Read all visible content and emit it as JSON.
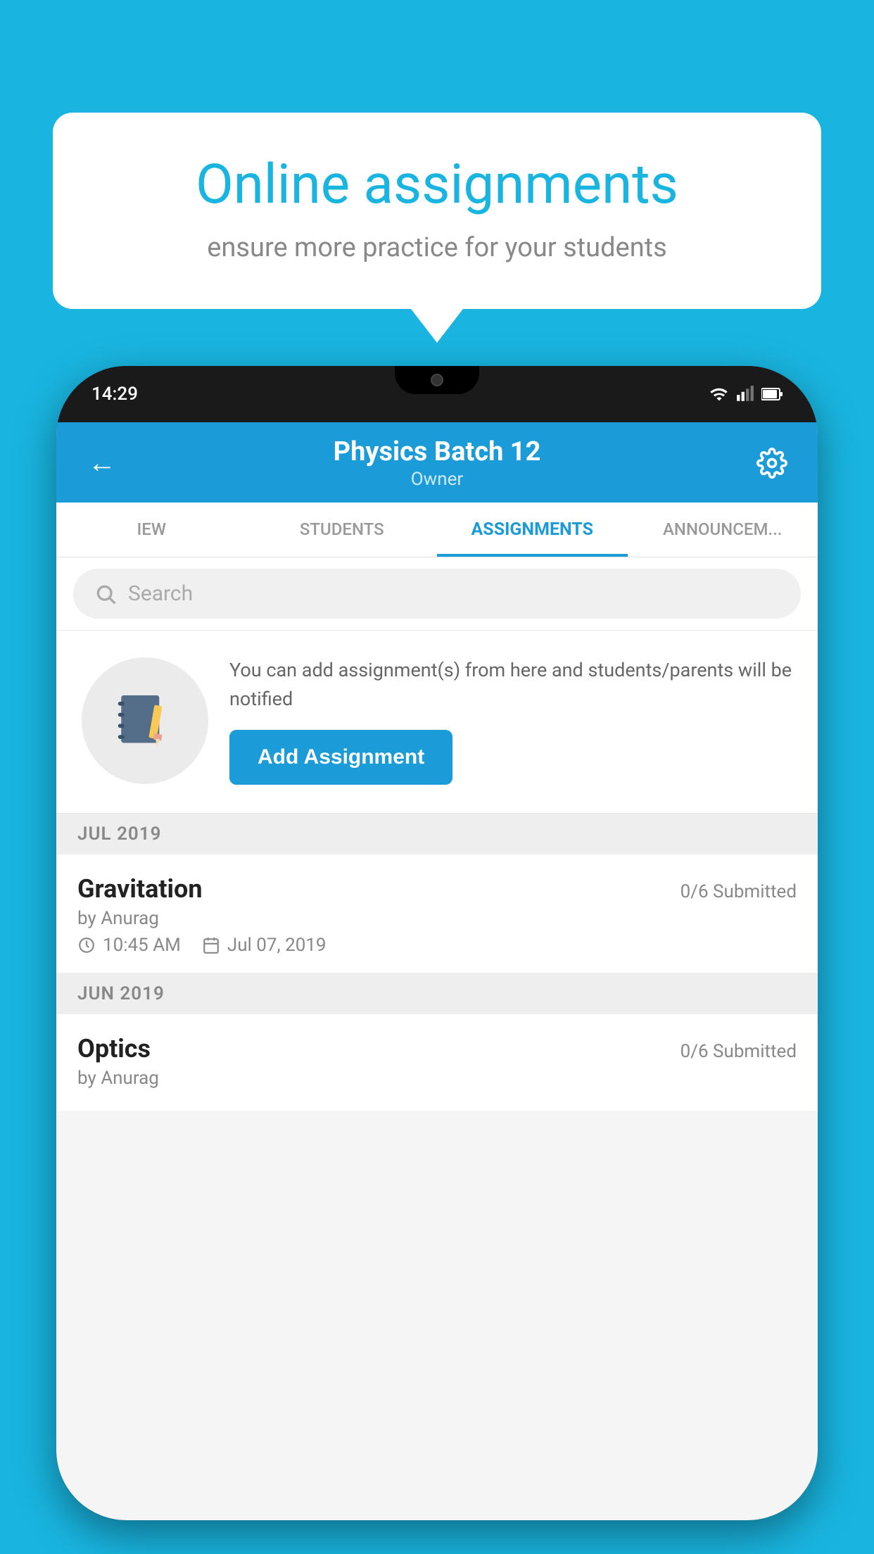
{
  "background_color": "#19b5e0",
  "speech_bubble": {
    "title": "Online assignments",
    "subtitle": "ensure more practice for your students"
  },
  "phone": {
    "status_time": "14:29",
    "header": {
      "title": "Physics Batch 12",
      "subtitle": "Owner",
      "back_label": "←",
      "settings_label": "settings"
    },
    "tabs": [
      {
        "label": "IEW",
        "active": false
      },
      {
        "label": "STUDENTS",
        "active": false
      },
      {
        "label": "ASSIGNMENTS",
        "active": true
      },
      {
        "label": "ANNOUNCEM...",
        "active": false
      }
    ],
    "search": {
      "placeholder": "Search"
    },
    "promo": {
      "text": "You can add assignment(s) from here and students/parents will be notified",
      "button_label": "Add Assignment"
    },
    "assignments": [
      {
        "section": "JUL 2019",
        "items": [
          {
            "title": "Gravitation",
            "status": "0/6 Submitted",
            "author": "by Anurag",
            "time": "10:45 AM",
            "date": "Jul 07, 2019"
          }
        ]
      },
      {
        "section": "JUN 2019",
        "items": [
          {
            "title": "Optics",
            "status": "0/6 Submitted",
            "author": "by Anurag",
            "time": "",
            "date": ""
          }
        ]
      }
    ]
  }
}
